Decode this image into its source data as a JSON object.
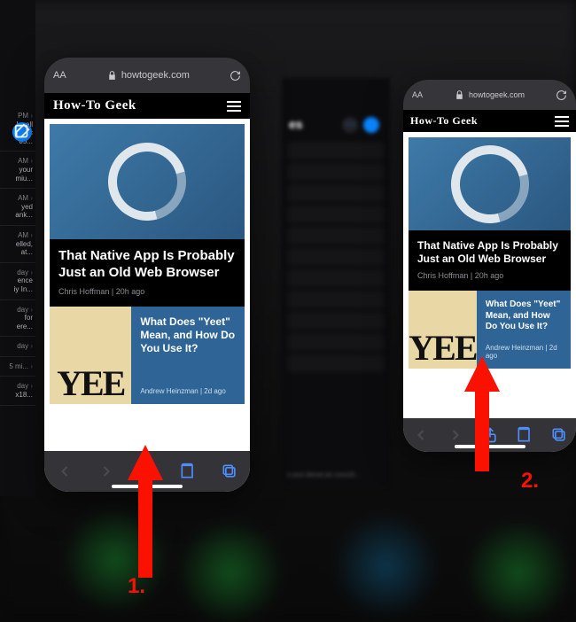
{
  "steps": {
    "one": "1.",
    "two": "2."
  },
  "colors": {
    "accent": "#0a84ff",
    "arrow": "#fa1100"
  },
  "left_sliver": {
    "compose_icon": "compose-icon",
    "rows": [
      {
        "time": "PM",
        "lines": [
          "k call",
          "r A/c",
          "05..."
        ]
      },
      {
        "time": "AM",
        "lines": [
          "your",
          "miu..."
        ]
      },
      {
        "time": "AM",
        "lines": [
          "yed",
          "ank..."
        ]
      },
      {
        "time": "AM",
        "lines": [
          "elled,",
          "at..."
        ]
      },
      {
        "time": "day",
        "lines": [
          "ence",
          "iy In..."
        ]
      },
      {
        "time": "day",
        "lines": [
          "for",
          "ere..."
        ]
      },
      {
        "time": "day",
        "lines": [
          ""
        ]
      },
      {
        "time": "5 mi...",
        "lines": [
          ""
        ]
      },
      {
        "time": "day",
        "lines": [
          "x18..."
        ]
      }
    ]
  },
  "middle_app": {
    "header_partial": "es",
    "footer_partial": "o your demat a/c xxxx18..."
  },
  "safari": {
    "addr_aa": "AA",
    "url": "howtogeek.com",
    "site_title": "How-To Geek",
    "article1": {
      "title": "That Native App Is Probably Just an Old Web Browser",
      "author": "Chris Hoffman",
      "age": "20h ago"
    },
    "article2": {
      "thumb_text": "YEE",
      "title": "What Does \"Yeet\" Mean, and How Do You Use It?",
      "author": "Andrew Heinzman",
      "age": "2d ago"
    }
  }
}
